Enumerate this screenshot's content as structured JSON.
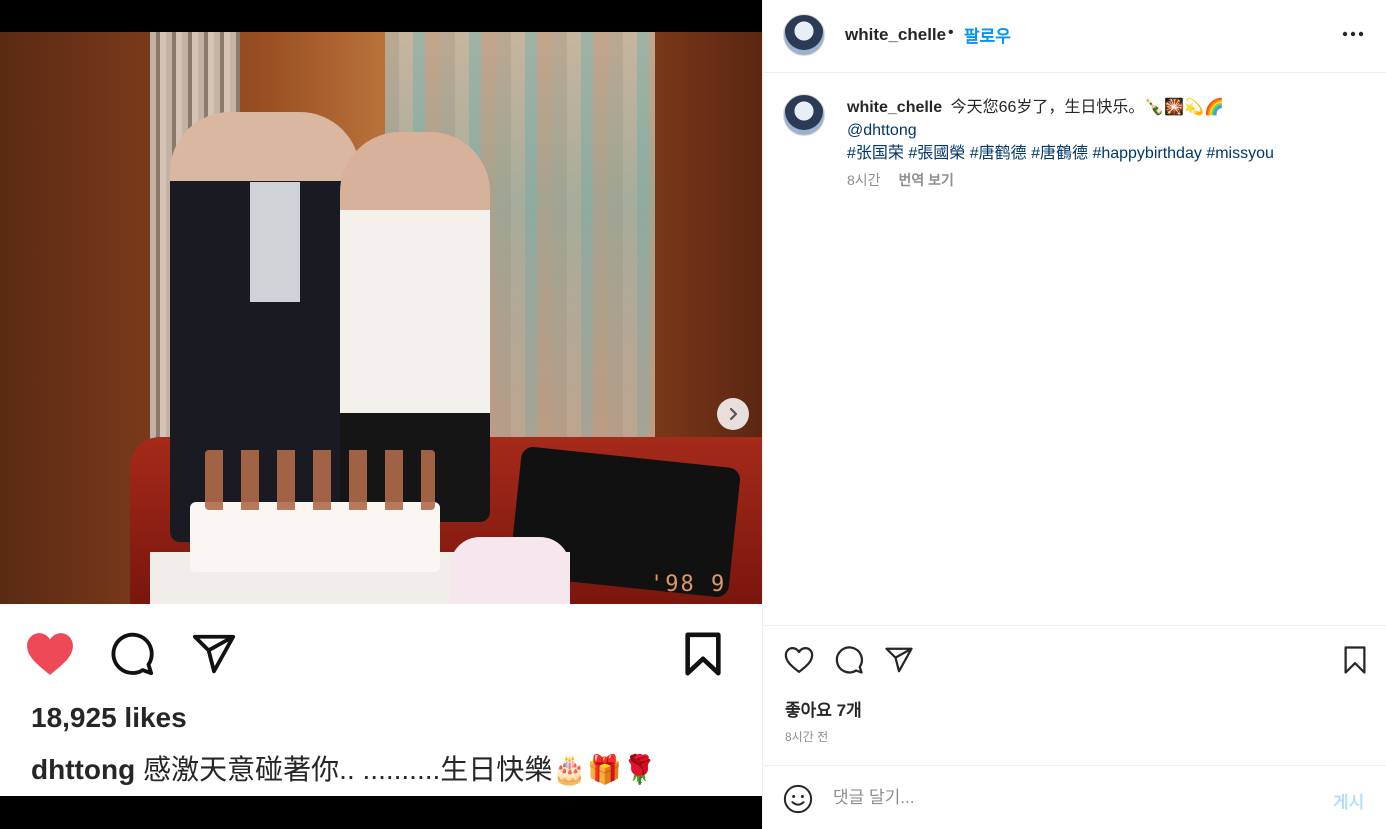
{
  "media": {
    "photo_stamp": "'98 9",
    "likes": "18,925 likes",
    "caption_user": "dhttong",
    "caption_text": "感激天意碰著你.. ..........生日快樂🎂🎁🌹"
  },
  "header": {
    "username": "white_chelle",
    "separator": "•",
    "follow_label": "팔로우"
  },
  "post": {
    "username": "white_chelle",
    "caption": "今天您66岁了，生日快乐。🍾🎇💫🌈",
    "mention": "@dhttong",
    "hashtags": [
      "#张国荣",
      "#張國榮",
      "#唐鹤德",
      "#唐鶴德",
      "#happybirthday",
      "#missyou"
    ],
    "time": "8시간",
    "translate_label": "번역 보기"
  },
  "stats": {
    "likes": "좋아요 7개",
    "time_ago": "8시간 전"
  },
  "comment_box": {
    "placeholder": "댓글 달기...",
    "post_label": "게시"
  },
  "icons": {
    "like_filled": "heart-filled-icon",
    "like": "heart-icon",
    "comment": "comment-icon",
    "share": "share-icon",
    "save": "bookmark-icon",
    "more": "more-icon",
    "next": "chevron-right-icon",
    "emoji": "emoji-icon"
  },
  "colors": {
    "accent": "#0095f6",
    "heart": "#ed4956",
    "link": "#00376b"
  }
}
